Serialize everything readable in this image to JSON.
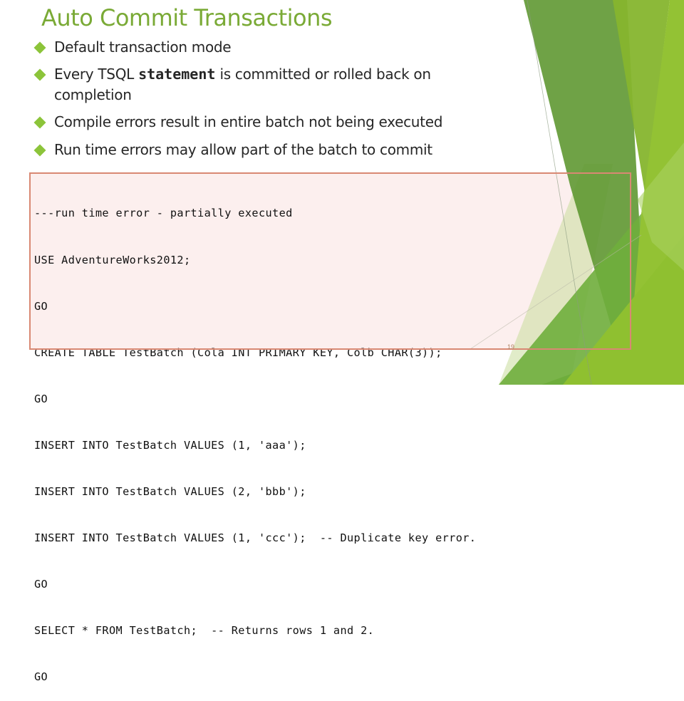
{
  "slide": {
    "title": "Auto Commit Transactions",
    "page_number": "19",
    "accent_color": "#7aaa36",
    "bullet_color": "#8cc43a",
    "code_border_color": "#d98873",
    "code_background_color": "#fbeceb"
  },
  "bullets": [
    {
      "prefix": "Default transaction mode",
      "bold": "",
      "suffix": "",
      "line2": ""
    },
    {
      "prefix": "Every TSQL ",
      "bold": "statement",
      "suffix": " is committed or rolled back on",
      "line2": "completion"
    },
    {
      "prefix": "Compile errors result in entire batch not being executed",
      "bold": "",
      "suffix": "",
      "line2": ""
    },
    {
      "prefix": "Run time errors may allow part of the batch to commit",
      "bold": "",
      "suffix": "",
      "line2": ""
    }
  ],
  "code": {
    "lines": [
      "---run time error - partially executed",
      "USE AdventureWorks2012;",
      "GO",
      "CREATE TABLE TestBatch (Cola INT PRIMARY KEY, Colb CHAR(3));",
      "GO",
      "INSERT INTO TestBatch VALUES (1, 'aaa');",
      "INSERT INTO TestBatch VALUES (2, 'bbb');",
      "INSERT INTO TestBatch VALUES (1, 'ccc');  -- Duplicate key error.",
      "GO",
      "SELECT * FROM TestBatch;  -- Returns rows 1 and 2.",
      "GO"
    ]
  }
}
